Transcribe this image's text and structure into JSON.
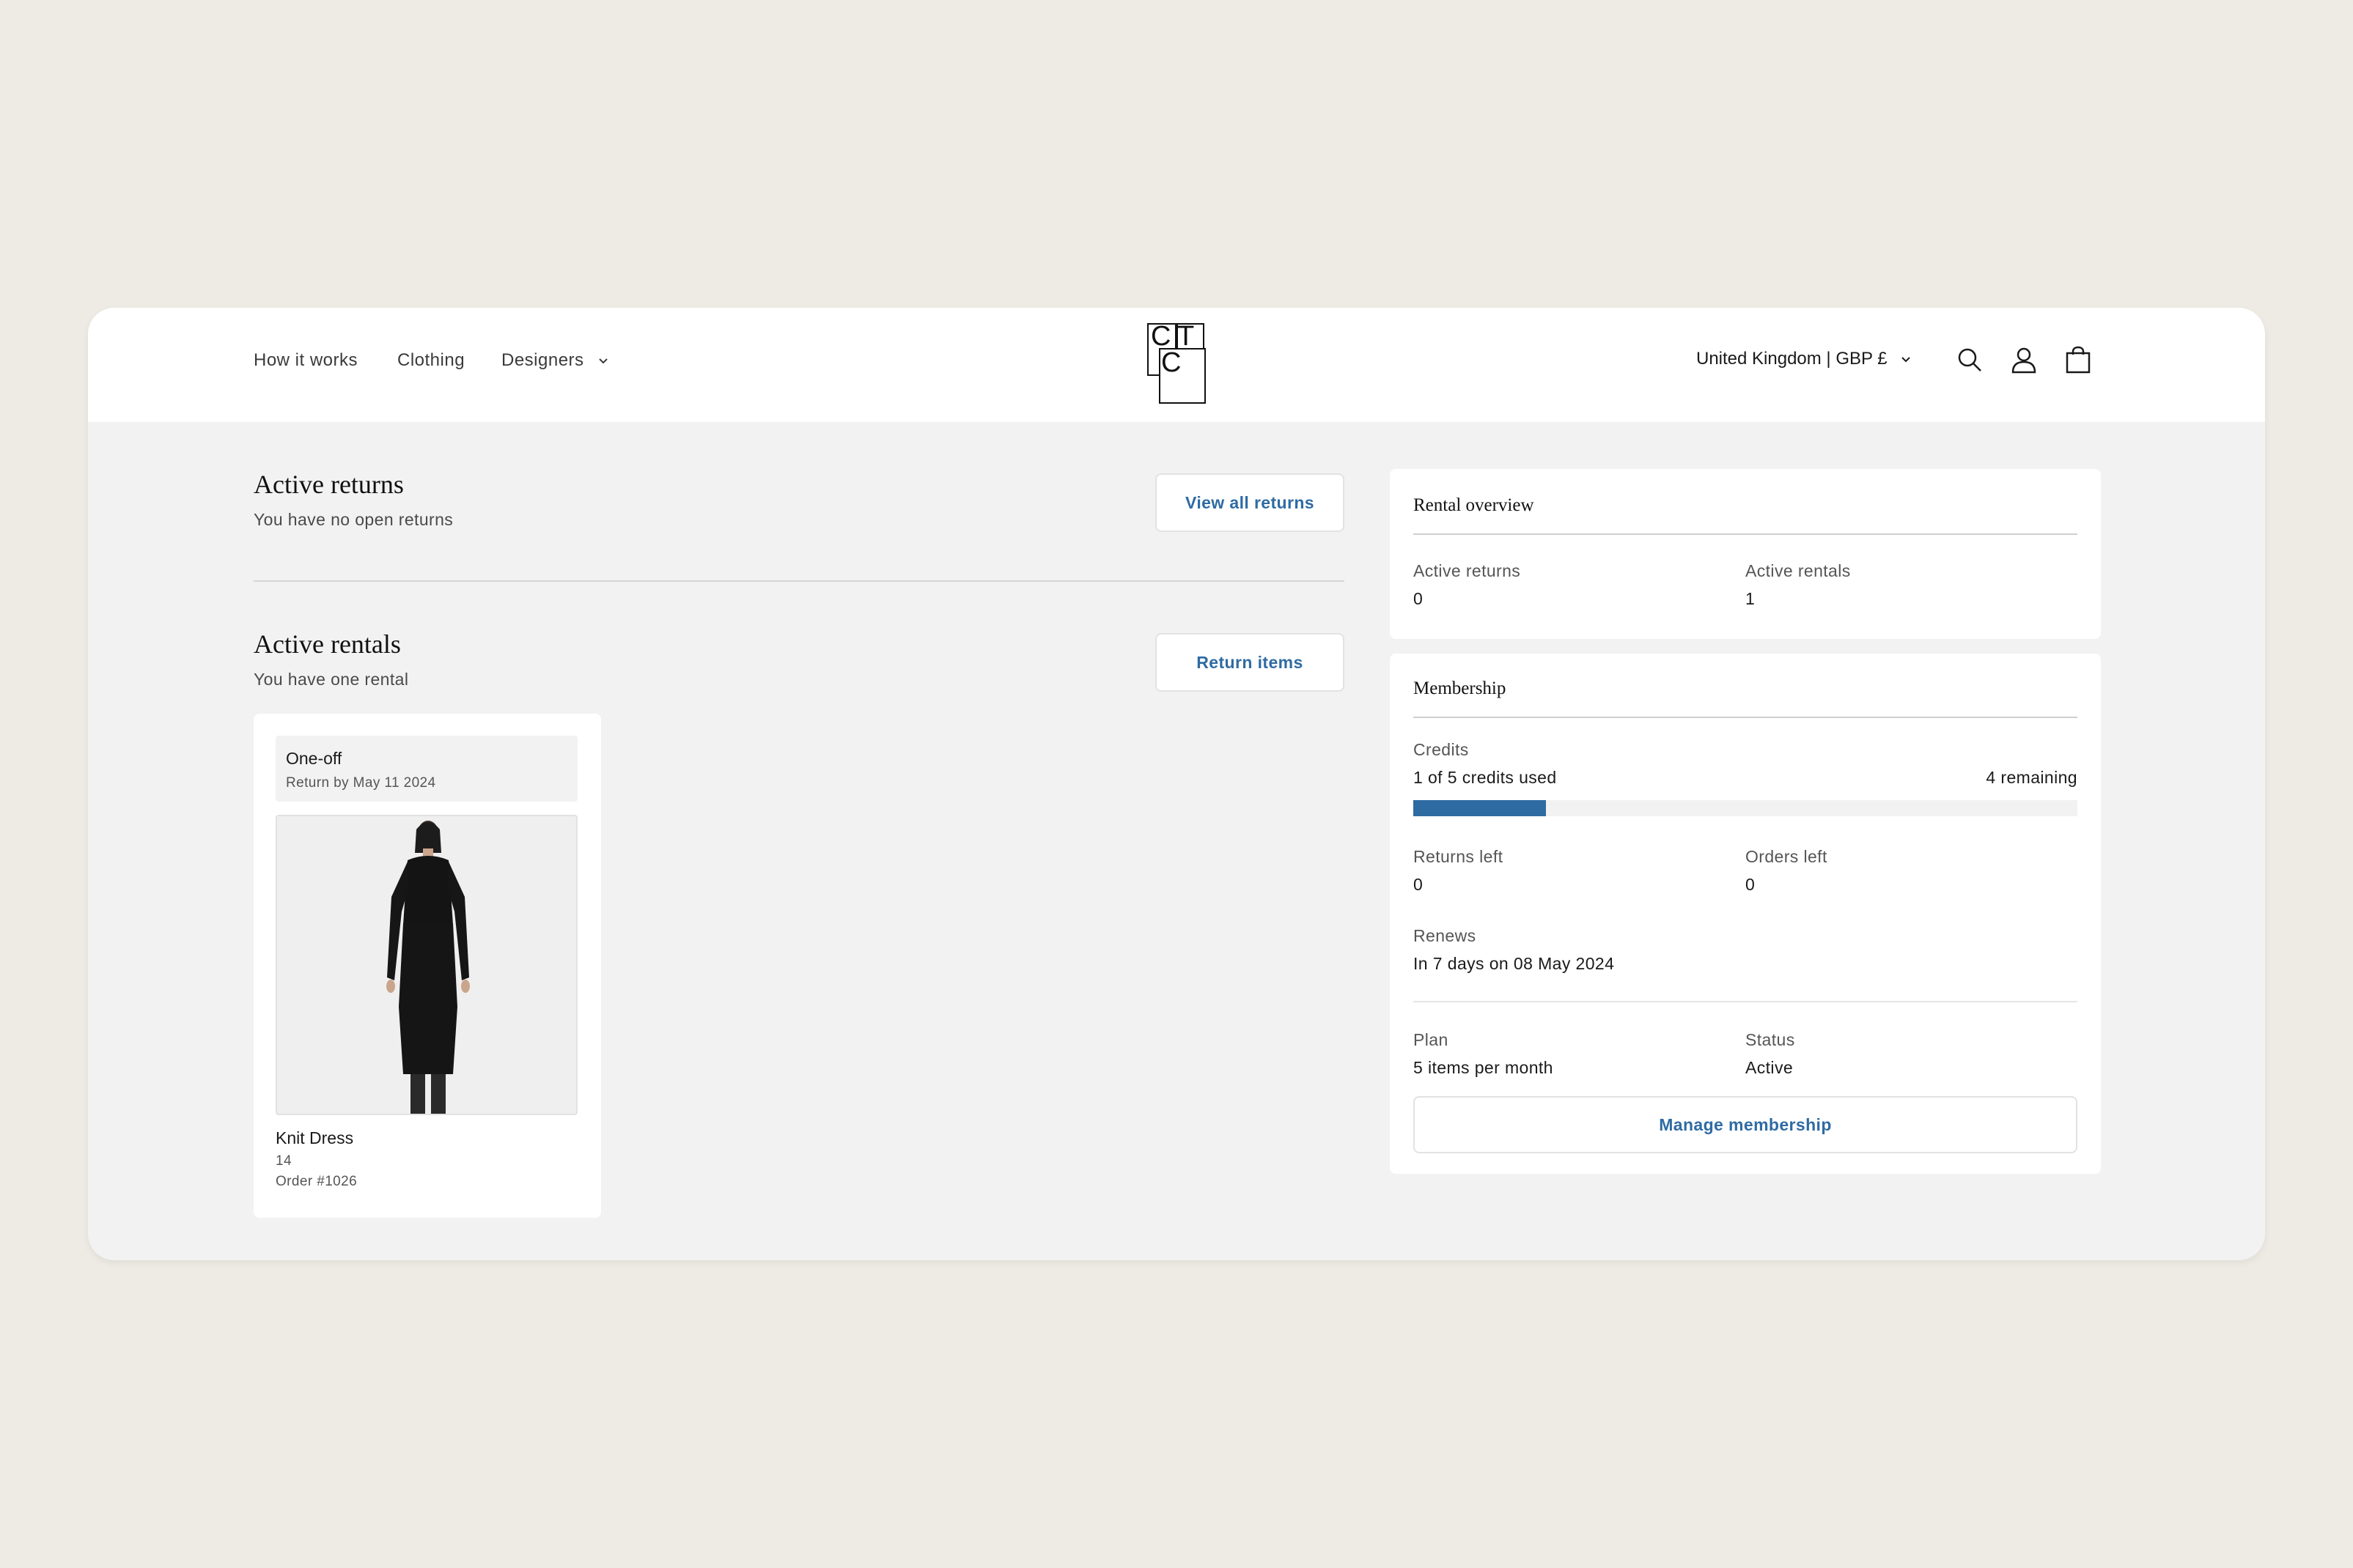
{
  "header": {
    "nav": [
      "How it works",
      "Clothing",
      "Designers"
    ],
    "logo_letters": [
      "C",
      "T",
      "C"
    ],
    "region": "United Kingdom | GBP £",
    "icons": [
      "search-icon",
      "account-icon",
      "cart-icon"
    ]
  },
  "returns": {
    "title": "Active returns",
    "subtitle": "You have no open returns",
    "button": "View all returns"
  },
  "rentals": {
    "title": "Active rentals",
    "subtitle": "You have one rental",
    "button": "Return items",
    "item": {
      "type": "One-off",
      "return_by": "Return by May 11 2024",
      "name": "Knit Dress",
      "size": "14",
      "order": "Order #1026"
    }
  },
  "overview": {
    "title": "Rental overview",
    "active_returns_label": "Active returns",
    "active_returns_value": "0",
    "active_rentals_label": "Active rentals",
    "active_rentals_value": "1"
  },
  "membership": {
    "title": "Membership",
    "credits_label": "Credits",
    "credits_used": "1 of 5 credits used",
    "credits_remaining": "4 remaining",
    "credits_progress": 0.2,
    "returns_left_label": "Returns left",
    "returns_left_value": "0",
    "orders_left_label": "Orders left",
    "orders_left_value": "0",
    "renews_label": "Renews",
    "renews_value": "In 7 days on 08 May 2024",
    "plan_label": "Plan",
    "plan_value": "5 items per month",
    "status_label": "Status",
    "status_value": "Active",
    "button": "Manage membership"
  },
  "colors": {
    "accent": "#2f6ba3",
    "page_background": "#eeebe4",
    "content_background": "#f2f2f2"
  }
}
